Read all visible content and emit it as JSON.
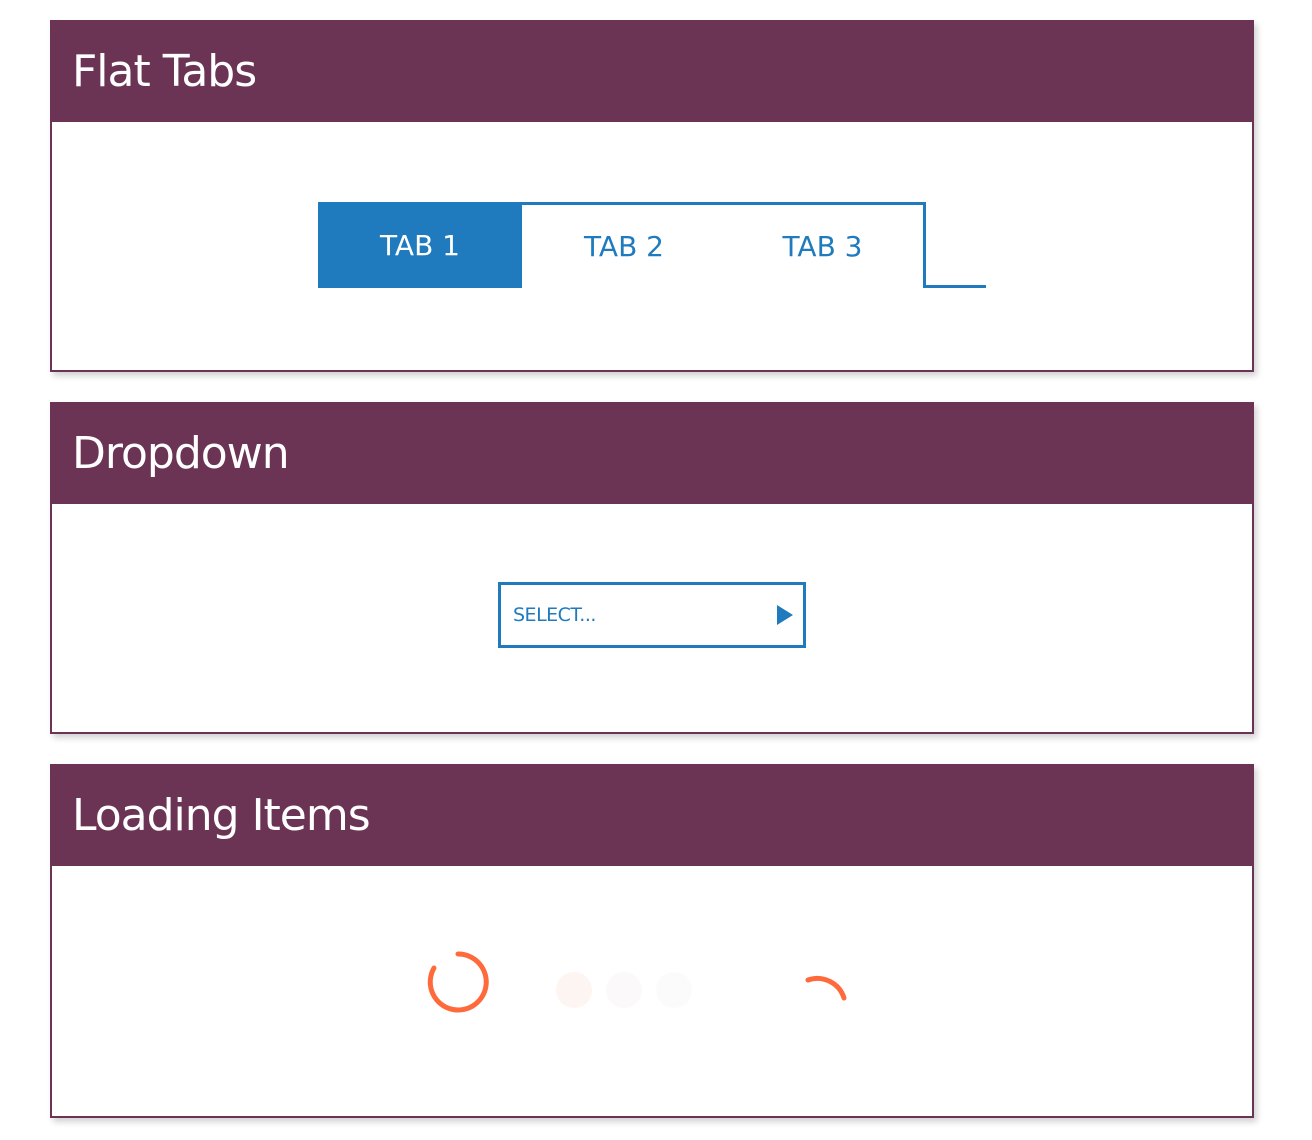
{
  "panels": {
    "tabs": {
      "title": "Flat Tabs",
      "tab_items": [
        {
          "label": "TAB 1",
          "active": true
        },
        {
          "label": "TAB 2",
          "active": false
        },
        {
          "label": "TAB 3",
          "active": false
        }
      ]
    },
    "dropdown": {
      "title": "Dropdown",
      "placeholder": "SELECT...",
      "arrow_icon": "caret-right-icon"
    },
    "loading": {
      "title": "Loading Items",
      "indicators": [
        "spinner-ring-icon",
        "loading-dots-icon",
        "spinner-arc-icon"
      ]
    }
  },
  "colors": {
    "header": "#6b3455",
    "accent": "#1f7bbd",
    "loader": "#ff6a3d",
    "background": "#ffffff"
  }
}
